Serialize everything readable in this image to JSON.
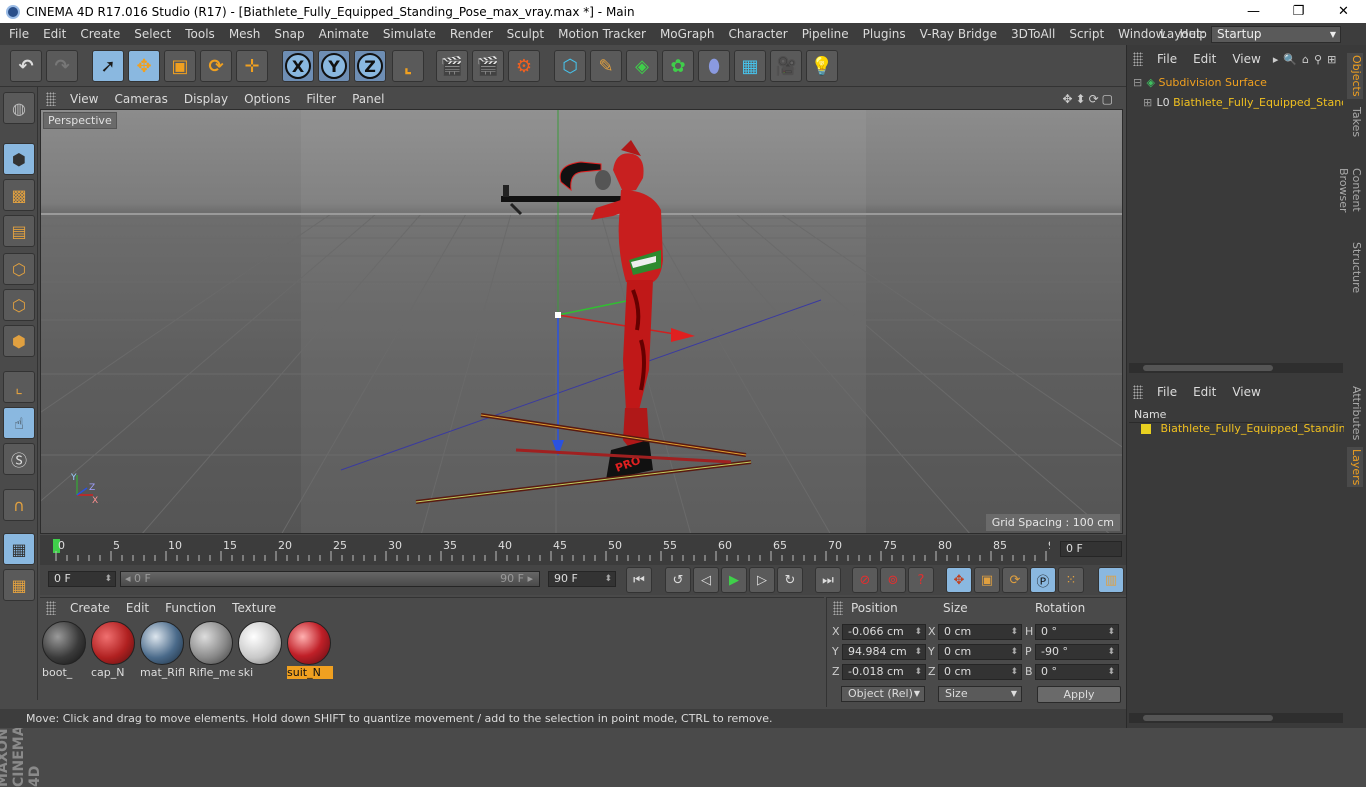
{
  "window": {
    "title": "CINEMA 4D R17.016 Studio (R17) - [Biathlete_Fully_Equipped_Standing_Pose_max_vray.max *] - Main",
    "controls": [
      "—",
      "❐",
      "✕"
    ]
  },
  "menubar": {
    "items": [
      "File",
      "Edit",
      "Create",
      "Select",
      "Tools",
      "Mesh",
      "Snap",
      "Animate",
      "Simulate",
      "Render",
      "Sculpt",
      "Motion Tracker",
      "MoGraph",
      "Character",
      "Pipeline",
      "Plugins",
      "V-Ray Bridge",
      "3DToAll",
      "Script",
      "Window",
      "Help"
    ],
    "layout_label": "Layout:",
    "layout_value": "Startup"
  },
  "toolbar": {
    "axis_x": "X",
    "axis_y": "Y",
    "axis_z": "Z"
  },
  "viewport": {
    "menu": [
      "View",
      "Cameras",
      "Display",
      "Options",
      "Filter",
      "Panel"
    ],
    "label": "Perspective",
    "grid_spacing": "Grid Spacing : 100 cm",
    "nav_icons": "✥⬍⟳▢",
    "axis_y": "Y",
    "axis_x": "X",
    "axis_z": "Z",
    "ski_text": "PRO"
  },
  "timeline": {
    "ticks": [
      "0",
      "5",
      "10",
      "15",
      "20",
      "25",
      "30",
      "35",
      "40",
      "45",
      "50",
      "55",
      "60",
      "65",
      "70",
      "75",
      "80",
      "85",
      "90"
    ],
    "current_frame": "0 F",
    "start": "0 F",
    "slider_start": "◂ 0 F",
    "slider_end": "90 F ▸",
    "end": "90 F"
  },
  "material_panel": {
    "menu": [
      "Create",
      "Edit",
      "Function",
      "Texture"
    ],
    "materials": [
      {
        "name": "boot_",
        "color": "#3a3a3a"
      },
      {
        "name": "cap_N",
        "color": "#b02020"
      },
      {
        "name": "mat_Rifl",
        "color": "#4a6a8a"
      },
      {
        "name": "Rifle_me",
        "color": "#8a8a8a"
      },
      {
        "name": "ski",
        "color": "#c8c8c8"
      },
      {
        "name": "suit_N",
        "color": "#c02028"
      }
    ]
  },
  "coordinates": {
    "headers": [
      "Position",
      "Size",
      "Rotation"
    ],
    "rows": [
      {
        "axis": "X",
        "position": "-0.066 cm",
        "size_axis": "X",
        "size": "0 cm",
        "rot_axis": "H",
        "rotation": "0 °"
      },
      {
        "axis": "Y",
        "position": "94.984 cm",
        "size_axis": "Y",
        "size": "0 cm",
        "rot_axis": "P",
        "rotation": "-90 °"
      },
      {
        "axis": "Z",
        "position": "-0.018 cm",
        "size_axis": "Z",
        "size": "0 cm",
        "rot_axis": "B",
        "rotation": "0 °"
      }
    ],
    "mode": "Object (Rel)",
    "size_mode": "Size",
    "apply": "Apply"
  },
  "statusbar": {
    "text": "Move: Click and drag to move elements. Hold down SHIFT to quantize movement / add to the selection in point mode, CTRL to remove."
  },
  "object_manager": {
    "menu": [
      "File",
      "Edit",
      "View"
    ],
    "objects": [
      {
        "name": "Subdivision Surface",
        "color": "#f0a020"
      },
      {
        "name": "Biathlete_Fully_Equipped_Standing_Pose",
        "color": "#f0c020"
      }
    ],
    "tabs": [
      "Objects",
      "Takes",
      "Content Browser",
      "Structure"
    ]
  },
  "layer_manager": {
    "menu": [
      "File",
      "Edit",
      "View"
    ],
    "column": "Name",
    "layers": [
      {
        "name": "Biathlete_Fully_Equipped_Standing_Pose",
        "color": "#e8d020"
      }
    ],
    "tabs": [
      "Attributes",
      "Layers"
    ]
  },
  "maxon_label": "MAXON CINEMA 4D"
}
